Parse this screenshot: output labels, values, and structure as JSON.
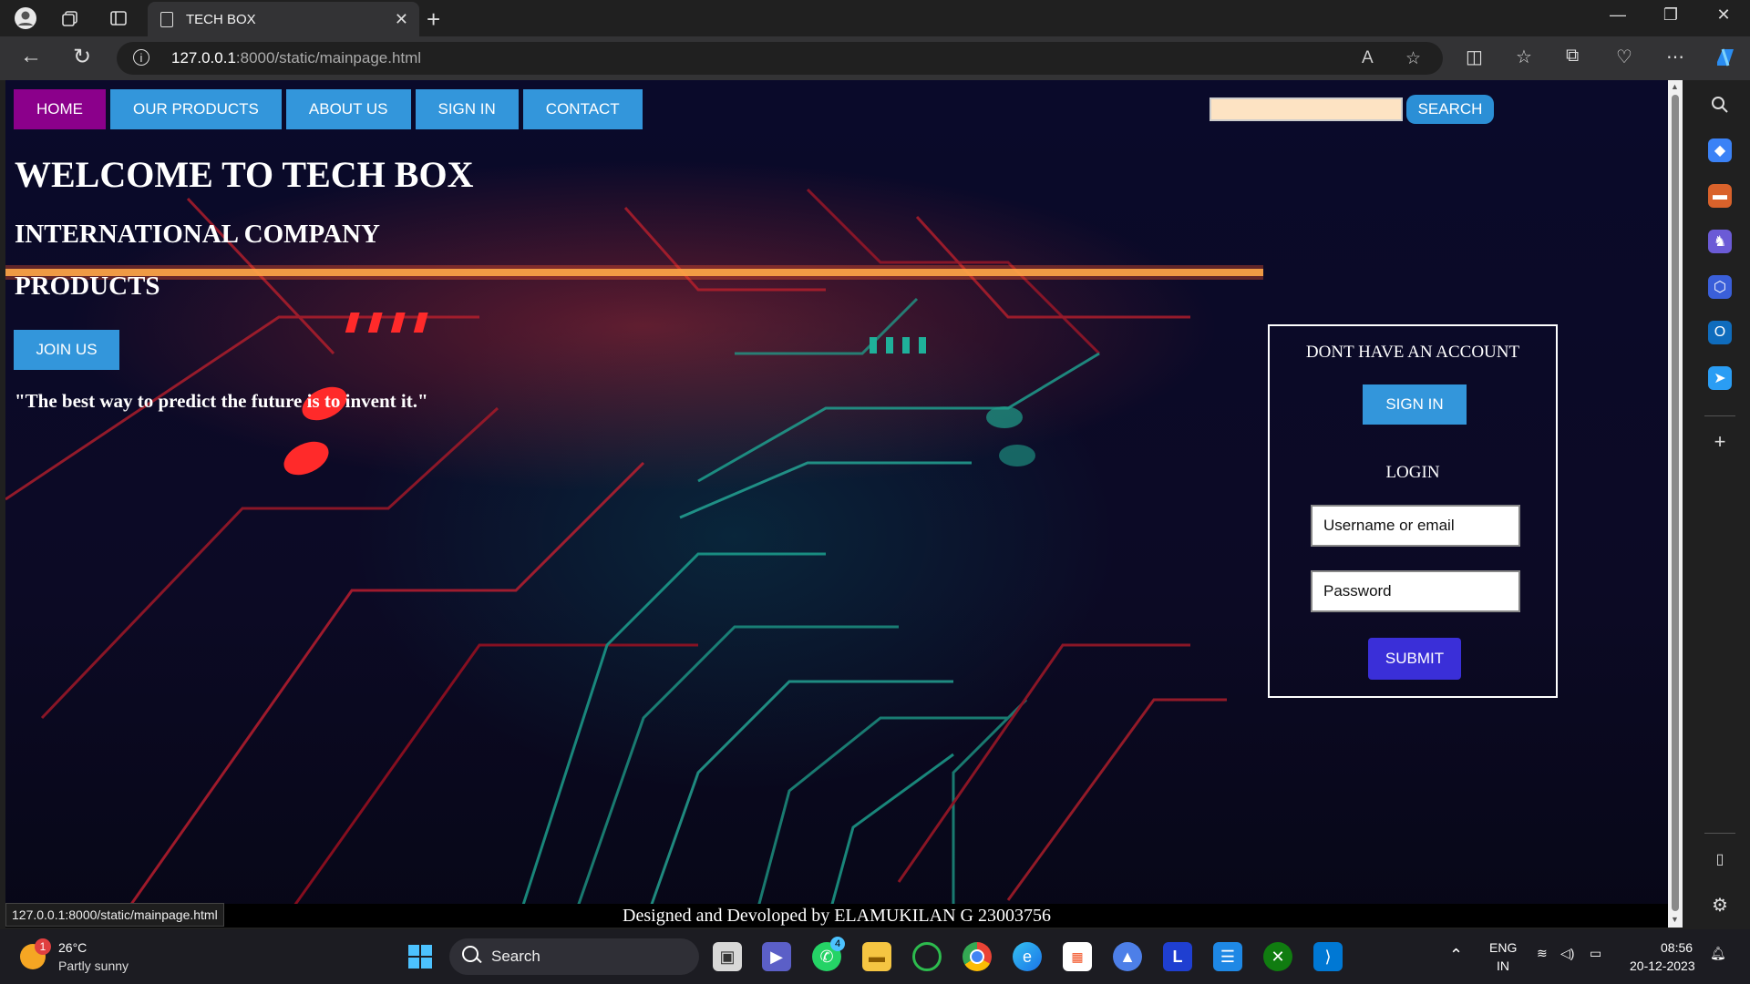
{
  "browser": {
    "tab_title": "TECH BOX",
    "url_host": "127.0.0.1",
    "url_path": ":8000/static/mainpage.html",
    "status_url": "127.0.0.1:8000/static/mainpage.html"
  },
  "page": {
    "nav": [
      {
        "label": "HOME",
        "active": true
      },
      {
        "label": "OUR PRODUCTS",
        "active": false
      },
      {
        "label": "ABOUT US",
        "active": false
      },
      {
        "label": "SIGN IN",
        "active": false
      },
      {
        "label": "CONTACT",
        "active": false
      }
    ],
    "search_button": "SEARCH",
    "welcome": "WELCOME TO TECH BOX",
    "line2": "INTERNATIONAL COMPANY",
    "line3": "PRODUCTS",
    "join_button": "JOIN US",
    "quote": "\"The best way to predict the future is to invent it.\"",
    "panel": {
      "no_account": "DONT HAVE AN ACCOUNT",
      "signin_button": "SIGN IN",
      "login_heading": "LOGIN",
      "username_placeholder": "Username or email",
      "password_placeholder": "Password",
      "submit_button": "SUBMIT"
    },
    "footer": "Designed and Devoloped by ELAMUKILAN G 23003756"
  },
  "taskbar": {
    "weather_temp": "26°C",
    "weather_desc": "Partly sunny",
    "weather_badge": "1",
    "search_label": "Search",
    "whatsapp_badge": "4",
    "lang_top": "ENG",
    "lang_bottom": "IN",
    "time": "08:56",
    "date": "20-12-2023"
  },
  "colors": {
    "nav_blue": "#3396db",
    "nav_active": "#8b008b",
    "submit": "#3a2fd8",
    "search_field": "#fde3c3"
  }
}
